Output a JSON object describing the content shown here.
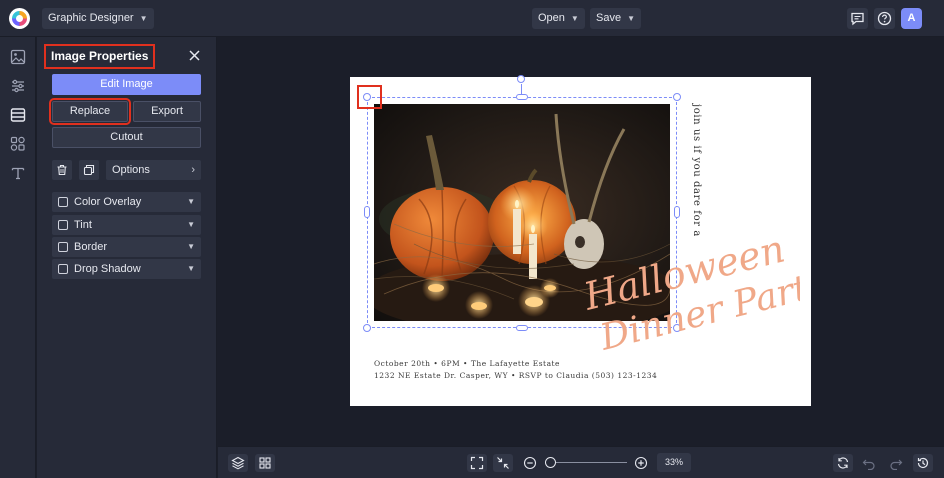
{
  "topbar": {
    "app_mode": "Graphic Designer",
    "open_label": "Open",
    "save_label": "Save",
    "avatar_initial": "A"
  },
  "rail": {
    "icons": [
      "image-icon",
      "adjustments-icon",
      "layout-icon",
      "graphics-icon",
      "text-icon"
    ]
  },
  "panel": {
    "title": "Image Properties",
    "edit_image": "Edit Image",
    "replace": "Replace",
    "export": "Export",
    "cutout": "Cutout",
    "options": "Options",
    "effects": [
      {
        "label": "Color Overlay",
        "checked": false
      },
      {
        "label": "Tint",
        "checked": false
      },
      {
        "label": "Border",
        "checked": false
      },
      {
        "label": "Drop Shadow",
        "checked": false
      }
    ]
  },
  "card": {
    "vertical_text": "join us if you dare for a",
    "script_line1": "Halloween",
    "script_line2": "Dinner Party",
    "details_line1": "October 20th • 6PM • The Lafayette Estate",
    "details_line2": "1232 NE Estate Dr. Casper, WY • RSVP to Claudia (503) 123-1234",
    "script_color": "#f0a888"
  },
  "bottombar": {
    "zoom_level": "33%",
    "zoom_fraction": 0.0
  },
  "colors": {
    "accent": "#7c8cf8",
    "highlight": "#e0301e",
    "panel_bg": "#262a38",
    "workspace_bg": "#1b1e29"
  }
}
